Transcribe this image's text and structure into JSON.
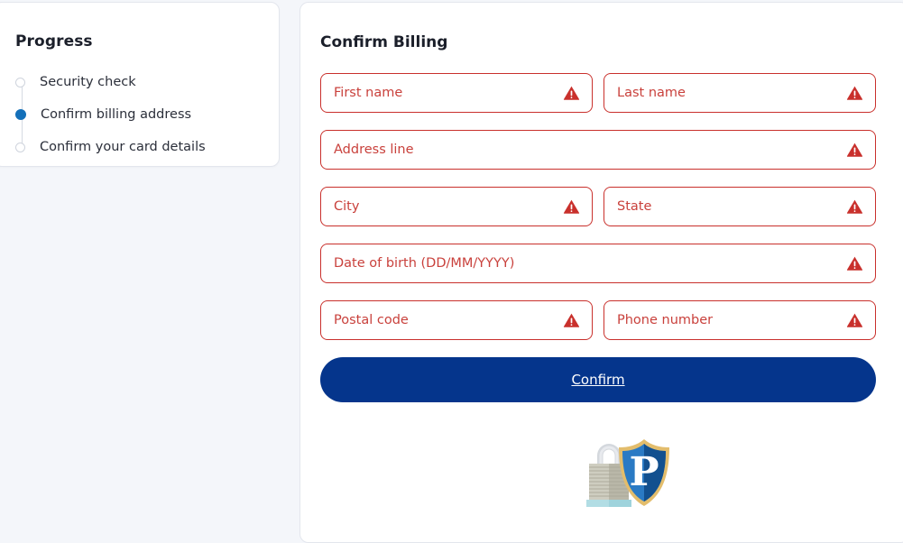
{
  "page": {
    "background_color": "#f4f6fa"
  },
  "progress": {
    "title": "Progress",
    "steps": [
      {
        "label": "Security check",
        "state": "pending"
      },
      {
        "label": "Confirm billing address",
        "state": "active"
      },
      {
        "label": "Confirm your card details",
        "state": "pending"
      }
    ],
    "active_dot_color": "#1470b9",
    "pending_dot_color": "#cfd4dd"
  },
  "billing": {
    "title": "Confirm Billing",
    "error_color": "#c9302c",
    "fields": [
      {
        "name": "first-name",
        "placeholder": "First name",
        "value": "",
        "error": true,
        "width": "half"
      },
      {
        "name": "last-name",
        "placeholder": "Last name",
        "value": "",
        "error": true,
        "width": "half"
      },
      {
        "name": "address-line",
        "placeholder": "Address line",
        "value": "",
        "error": true,
        "width": "full"
      },
      {
        "name": "city",
        "placeholder": "City",
        "value": "",
        "error": true,
        "width": "half"
      },
      {
        "name": "state",
        "placeholder": "State",
        "value": "",
        "error": true,
        "width": "half"
      },
      {
        "name": "date-of-birth",
        "placeholder": "Date of birth (DD/MM/YYYY)",
        "value": "",
        "error": true,
        "width": "full"
      },
      {
        "name": "postal-code",
        "placeholder": "Postal code",
        "value": "",
        "error": true,
        "width": "half"
      },
      {
        "name": "phone-number",
        "placeholder": "Phone number",
        "value": "",
        "error": true,
        "width": "half"
      }
    ],
    "submit_label": "Confirm",
    "submit_color": "#05358c",
    "warning_icon": "warning-triangle-icon"
  },
  "security_badge": {
    "lock_icon": "padlock-icon",
    "shield_icon": "shield-p-icon",
    "shield_letter": "P",
    "shield_border_color": "#e0b964",
    "shield_fill_color": "#1f63a8"
  }
}
